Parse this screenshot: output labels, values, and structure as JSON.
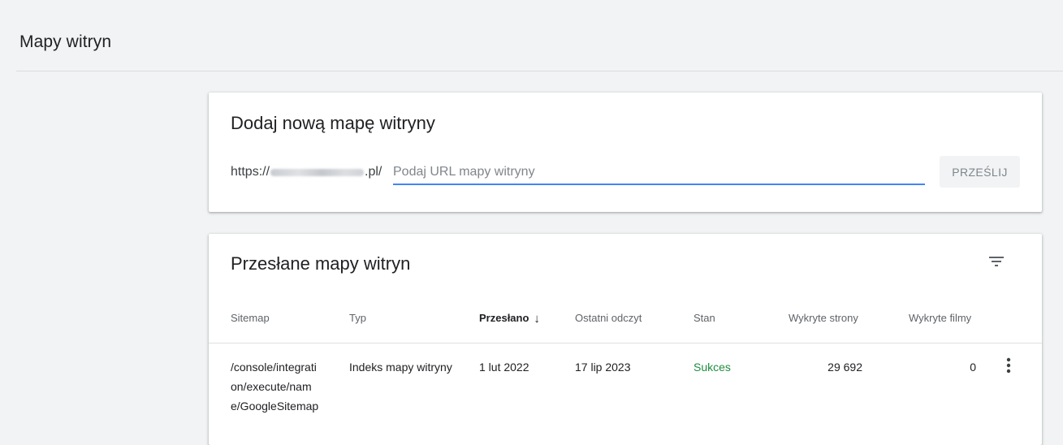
{
  "page": {
    "title": "Mapy witryn"
  },
  "add_sitemap": {
    "title": "Dodaj nową mapę witryny",
    "url_prefix_start": "https://",
    "url_prefix_end": ".pl/",
    "input_value": "",
    "input_placeholder": "Podaj URL mapy witryny",
    "submit_label": "PRZEŚLIJ"
  },
  "submitted": {
    "title": "Przesłane mapy witryn",
    "columns": {
      "sitemap": "Sitemap",
      "type": "Typ",
      "submitted": "Przesłano",
      "last_read": "Ostatni odczyt",
      "status": "Stan",
      "pages": "Wykryte strony",
      "videos": "Wykryte filmy"
    },
    "sort": {
      "column": "submitted",
      "arrow": "↓"
    },
    "rows": [
      {
        "sitemap": "/console/integration/execute/name/GoogleSitemap",
        "type": "Indeks mapy witryny",
        "submitted": "1 lut 2022",
        "last_read": "17 lip 2023",
        "status": "Sukces",
        "pages": "29 692",
        "videos": "0"
      }
    ]
  },
  "colors": {
    "accent": "#4285f4",
    "success": "#1e8e3e",
    "background": "#f1f3f4"
  },
  "icons": {
    "filter": "filter-icon",
    "more": "more-vert-icon"
  }
}
